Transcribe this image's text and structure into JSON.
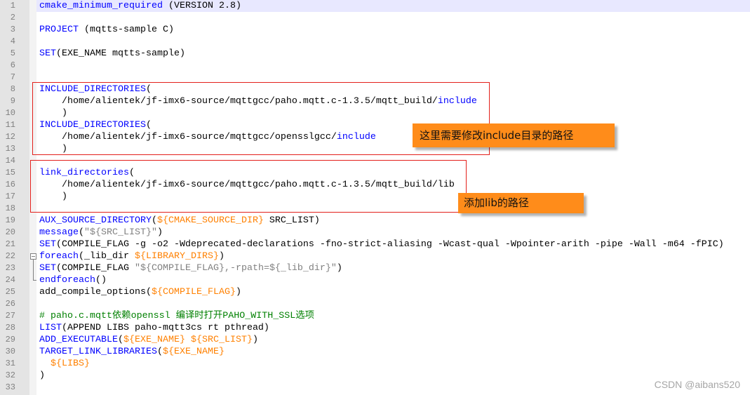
{
  "colors": {
    "current_line": "#E8E8FF",
    "annotation_border": "#E3201B",
    "callout_fill": "#FF8C1A"
  },
  "editor": {
    "current_line": 1,
    "lines": [
      {
        "number": "1",
        "tokens": [
          {
            "text": "cmake_minimum_required",
            "color": "#0000FF"
          },
          {
            "text": " (VERSION 2.8)",
            "color": "#000000"
          }
        ]
      },
      {
        "number": "2",
        "tokens": []
      },
      {
        "number": "3",
        "tokens": [
          {
            "text": "PROJECT",
            "color": "#0000FF"
          },
          {
            "text": " (mqtts-sample C)",
            "color": "#000000"
          }
        ]
      },
      {
        "number": "4",
        "tokens": []
      },
      {
        "number": "5",
        "tokens": [
          {
            "text": "SET",
            "color": "#0000FF"
          },
          {
            "text": "(EXE_NAME mqtts-sample)",
            "color": "#000000"
          }
        ]
      },
      {
        "number": "6",
        "tokens": []
      },
      {
        "number": "7",
        "tokens": []
      },
      {
        "number": "8",
        "tokens": [
          {
            "text": "INCLUDE_DIRECTORIES",
            "color": "#0000FF"
          },
          {
            "text": "(",
            "color": "#000000"
          }
        ]
      },
      {
        "number": "9",
        "tokens": [
          {
            "text": "    /home/alientek/jf-imx6-source/mqttgcc/paho.mqtt.c-1.3.5/mqtt_build/",
            "color": "#000000"
          },
          {
            "text": "include",
            "color": "#0000FF"
          }
        ]
      },
      {
        "number": "10",
        "tokens": [
          {
            "text": "    )",
            "color": "#000000"
          }
        ]
      },
      {
        "number": "11",
        "tokens": [
          {
            "text": "INCLUDE_DIRECTORIES",
            "color": "#0000FF"
          },
          {
            "text": "(",
            "color": "#000000"
          }
        ]
      },
      {
        "number": "12",
        "tokens": [
          {
            "text": "    /home/alientek/jf-imx6-source/mqttgcc/opensslgcc/",
            "color": "#000000"
          },
          {
            "text": "include",
            "color": "#0000FF"
          }
        ]
      },
      {
        "number": "13",
        "tokens": [
          {
            "text": "    )",
            "color": "#000000"
          }
        ]
      },
      {
        "number": "14",
        "tokens": []
      },
      {
        "number": "15",
        "tokens": [
          {
            "text": "link_directories",
            "color": "#0000FF"
          },
          {
            "text": "(",
            "color": "#000000"
          }
        ]
      },
      {
        "number": "16",
        "tokens": [
          {
            "text": "    /home/alientek/jf-imx6-source/mqttgcc/paho.mqtt.c-1.3.5/mqtt_build/lib",
            "color": "#000000"
          }
        ]
      },
      {
        "number": "17",
        "tokens": [
          {
            "text": "    )",
            "color": "#000000"
          }
        ]
      },
      {
        "number": "18",
        "tokens": []
      },
      {
        "number": "19",
        "tokens": [
          {
            "text": "AUX_SOURCE_DIRECTORY",
            "color": "#0000FF"
          },
          {
            "text": "(",
            "color": "#000000"
          },
          {
            "text": "${CMAKE_SOURCE_DIR}",
            "color": "#FF8000"
          },
          {
            "text": " SRC_LIST)",
            "color": "#000000"
          }
        ]
      },
      {
        "number": "20",
        "tokens": [
          {
            "text": "message",
            "color": "#0000FF"
          },
          {
            "text": "(",
            "color": "#000000"
          },
          {
            "text": "\"${SRC_LIST}\"",
            "color": "#808080"
          },
          {
            "text": ")",
            "color": "#000000"
          }
        ]
      },
      {
        "number": "21",
        "tokens": [
          {
            "text": "SET",
            "color": "#0000FF"
          },
          {
            "text": "(COMPILE_FLAG -g -o2 -Wdeprecated-declarations -fno-strict-aliasing -Wcast-qual -Wpointer-arith -pipe -Wall -m64 -fPIC)",
            "color": "#000000"
          }
        ]
      },
      {
        "number": "22",
        "tokens": [
          {
            "text": "foreach",
            "color": "#0000FF"
          },
          {
            "text": "(_lib_dir ",
            "color": "#000000"
          },
          {
            "text": "${LIBRARY_DIRS}",
            "color": "#FF8000"
          },
          {
            "text": ")",
            "color": "#000000"
          }
        ]
      },
      {
        "number": "23",
        "tokens": [
          {
            "text": "SET",
            "color": "#0000FF"
          },
          {
            "text": "(COMPILE_FLAG ",
            "color": "#000000"
          },
          {
            "text": "\"${COMPILE_FLAG},-rpath=${_lib_dir}\"",
            "color": "#808080"
          },
          {
            "text": ")",
            "color": "#000000"
          }
        ]
      },
      {
        "number": "24",
        "tokens": [
          {
            "text": "endforeach",
            "color": "#0000FF"
          },
          {
            "text": "()",
            "color": "#000000"
          }
        ]
      },
      {
        "number": "25",
        "tokens": [
          {
            "text": "add_compile_options(",
            "color": "#000000"
          },
          {
            "text": "${COMPILE_FLAG}",
            "color": "#FF8000"
          },
          {
            "text": ")",
            "color": "#000000"
          }
        ]
      },
      {
        "number": "26",
        "tokens": []
      },
      {
        "number": "27",
        "tokens": [
          {
            "text": "# paho.c.mqtt依赖openssl 编译时打开PAHO_WITH_SSL选项",
            "color": "#008000"
          }
        ]
      },
      {
        "number": "28",
        "tokens": [
          {
            "text": "LIST",
            "color": "#0000FF"
          },
          {
            "text": "(APPEND LIBS paho-mqtt3cs rt pthread)",
            "color": "#000000"
          }
        ]
      },
      {
        "number": "29",
        "tokens": [
          {
            "text": "ADD_EXECUTABLE",
            "color": "#0000FF"
          },
          {
            "text": "(",
            "color": "#000000"
          },
          {
            "text": "${EXE_NAME}",
            "color": "#FF8000"
          },
          {
            "text": " ${SRC_LIST}",
            "color": "#FF8000"
          },
          {
            "text": ")",
            "color": "#000000"
          }
        ]
      },
      {
        "number": "30",
        "tokens": [
          {
            "text": "TARGET_LINK_LIBRARIES",
            "color": "#0000FF"
          },
          {
            "text": "(",
            "color": "#000000"
          },
          {
            "text": "${EXE_NAME}",
            "color": "#FF8000"
          }
        ]
      },
      {
        "number": "31",
        "tokens": [
          {
            "text": "  ${LIBS}",
            "color": "#FF8000"
          }
        ]
      },
      {
        "number": "32",
        "tokens": [
          {
            "text": ")",
            "color": "#000000"
          }
        ]
      },
      {
        "number": "33",
        "tokens": []
      }
    ]
  },
  "annotations": {
    "include_note": "这里需要修改include目录的路径",
    "lib_note": "添加lib的路径"
  },
  "watermark": "CSDN @aibans520"
}
